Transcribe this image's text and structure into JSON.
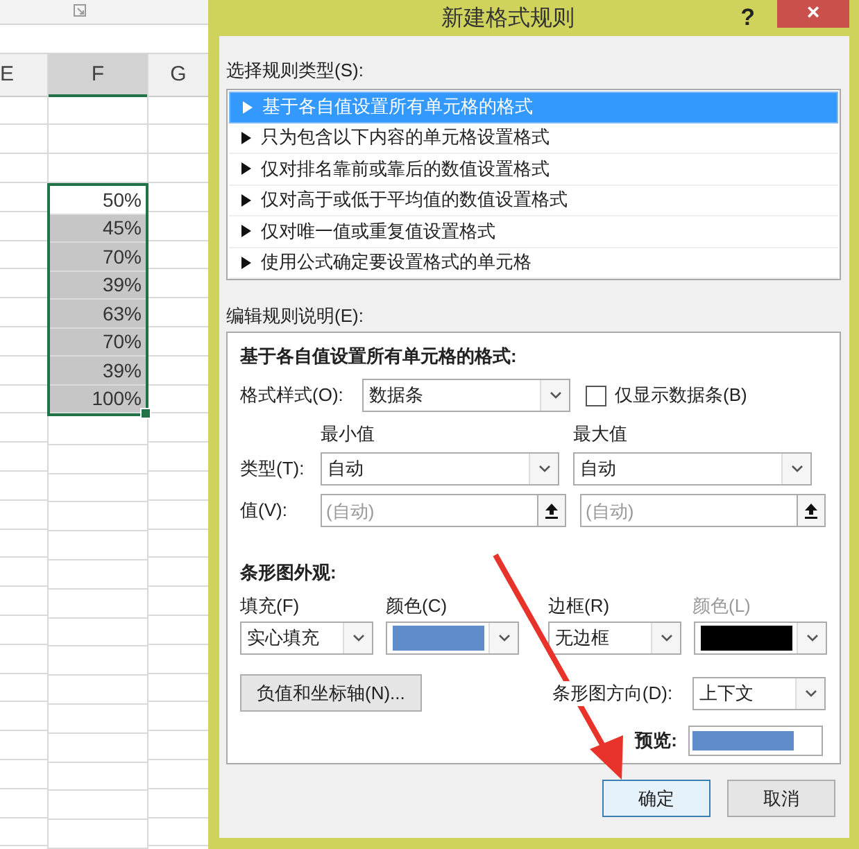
{
  "window": {
    "title": "新建格式规则",
    "help": "?",
    "close": "×"
  },
  "spreadsheet": {
    "columns": [
      {
        "label": "E",
        "selected": false
      },
      {
        "label": "F",
        "selected": true
      },
      {
        "label": "G",
        "selected": false
      }
    ],
    "f_cells": [
      {
        "value": "50%",
        "active": true
      },
      {
        "value": "45%",
        "active": false
      },
      {
        "value": "70%",
        "active": false
      },
      {
        "value": "39%",
        "active": false
      },
      {
        "value": "63%",
        "active": false
      },
      {
        "value": "70%",
        "active": false
      },
      {
        "value": "39%",
        "active": false
      },
      {
        "value": "100%",
        "active": false
      }
    ]
  },
  "rule_type": {
    "label": "选择规则类型(S):",
    "items": [
      {
        "label": "基于各自值设置所有单元格的格式",
        "selected": true
      },
      {
        "label": "只为包含以下内容的单元格设置格式",
        "selected": false
      },
      {
        "label": "仅对排名靠前或靠后的数值设置格式",
        "selected": false
      },
      {
        "label": "仅对高于或低于平均值的数值设置格式",
        "selected": false
      },
      {
        "label": "仅对唯一值或重复值设置格式",
        "selected": false
      },
      {
        "label": "使用公式确定要设置格式的单元格",
        "selected": false
      }
    ]
  },
  "rule_description": {
    "label": "编辑规则说明(E):",
    "heading": "基于各自值设置所有单元格的格式:",
    "format_style": {
      "label": "格式样式(O):",
      "value": "数据条"
    },
    "bar_only": {
      "label": "仅显示数据条(B)",
      "checked": false
    },
    "type_label": "类型(T):",
    "value_label": "值(V):",
    "minimum": {
      "header": "最小值",
      "type": "自动",
      "value": {
        "placeholder": "(自动)"
      }
    },
    "maximum": {
      "header": "最大值",
      "type": "自动",
      "value": {
        "placeholder": "(自动)"
      }
    },
    "bar_appearance": {
      "heading": "条形图外观:",
      "fill": {
        "label": "填充(F)",
        "value": "实心填充"
      },
      "fill_color": {
        "label": "颜色(C)",
        "color": "#5f8dc9",
        "disabled": false
      },
      "border": {
        "label": "边框(R)",
        "value": "无边框"
      },
      "border_color": {
        "label": "颜色(L)",
        "color": "#000000",
        "disabled": true
      },
      "axis_button": "负值和坐标轴(N)...",
      "direction": {
        "label": "条形图方向(D):",
        "value": "上下文"
      },
      "preview_label": "预览:"
    }
  },
  "buttons": [
    {
      "label": "确定",
      "default": true
    },
    {
      "label": "取消",
      "default": false
    }
  ],
  "annotation": {
    "kind": "arrow"
  }
}
